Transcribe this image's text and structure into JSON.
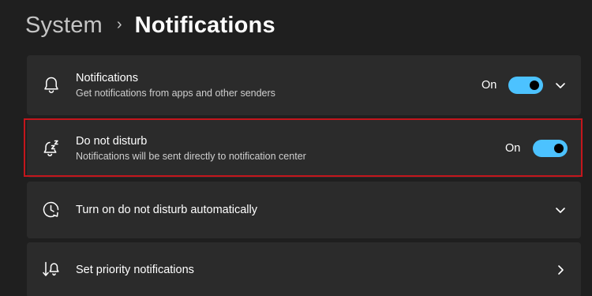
{
  "breadcrumb": {
    "parent": "System",
    "separator": "›",
    "current": "Notifications"
  },
  "settings": [
    {
      "title": "Notifications",
      "subtitle": "Get notifications from apps and other senders",
      "state_label": "On",
      "toggle_on": true,
      "icon": "bell-icon",
      "affordance": "expand"
    },
    {
      "title": "Do not disturb",
      "subtitle": "Notifications will be sent directly to notification center",
      "state_label": "On",
      "toggle_on": true,
      "icon": "bell-snooze-icon",
      "highlighted": true
    },
    {
      "title": "Turn on do not disturb automatically",
      "icon": "clock-refresh-icon",
      "affordance": "expand"
    },
    {
      "title": "Set priority notifications",
      "icon": "priority-bell-icon",
      "affordance": "navigate"
    }
  ],
  "colors": {
    "background": "#1f1f1f",
    "card": "#2b2b2b",
    "accent": "#4cc2ff",
    "highlight_border": "#c4161c"
  }
}
